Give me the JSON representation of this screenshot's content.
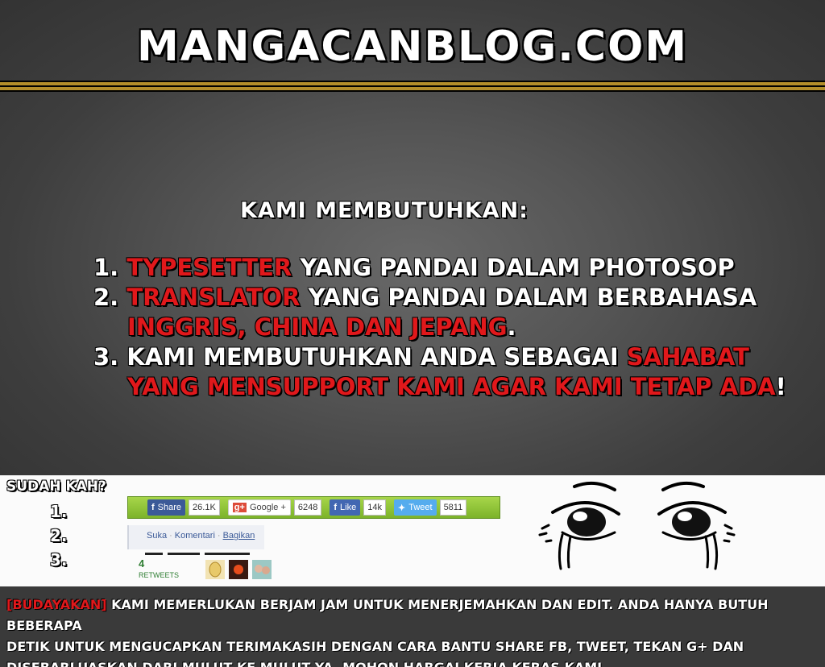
{
  "header": {
    "site_title": "MANGACANBLOG.COM"
  },
  "main": {
    "headline": "KAMI MEMBUTUHKAN:",
    "items": [
      {
        "num": "1.",
        "highlight": "TYPESETTER",
        "text": " YANG PANDAI DALAM PHOTOSOP"
      },
      {
        "num": "2.",
        "highlight": "TRANSLATOR",
        "text": " YANG PANDAI DALAM BERBAHASA",
        "line2_highlight": "INGGRIS, CHINA DAN JEPANG",
        "line2_end": "."
      },
      {
        "num": "3.",
        "text": " KAMI MEMBUTUHKAN ANDA SEBAGAI ",
        "highlight": "SAHABAT",
        "line2_highlight": "YANG MENSUPPORT KAMI AGAR KAMI TETAP ADA",
        "line2_end": "!"
      }
    ]
  },
  "sidebar": {
    "question": "SUDAH KAH?",
    "numbers": [
      "1.",
      "2.",
      "3."
    ]
  },
  "share_bar": {
    "fb_share_label": "Share",
    "fb_share_count": "26.1K",
    "gplus_label": "Google +",
    "gplus_count": "6248",
    "like_label": "Like",
    "like_count": "14k",
    "tweet_label": "Tweet",
    "tweet_count": "5811",
    "colors": {
      "bar": "#8cc43a",
      "facebook": "#3b5a98",
      "twitter": "#55acee",
      "google": "#dd4b39"
    }
  },
  "fb_links": {
    "suka": "Suka",
    "sep": "·",
    "komentari": "Komentari",
    "bagikan": "Bagikan"
  },
  "retweets": {
    "count": "4",
    "label": "RETWEETS"
  },
  "footer": {
    "tag": "[BUDAYAKAN]",
    "line1": " KAMI MEMERLUKAN BERJAM JAM UNTUK MENERJEMAHKAN DAN EDIT. ANDA HANYA BUTUH BEBERAPA",
    "line2": "DETIK UNTUK MENGUCAPKAN TERIMAKASIH DENGAN CARA BANTU SHARE FB, TWEET, TEKAN G+ DAN",
    "line3": "DISEBARLUASKAN DARI MULUT KE MULUT YA, MOHON HARGAI KERJA KERAS KAMI."
  },
  "icons": {
    "facebook": "facebook-icon",
    "google_plus": "google-plus-icon",
    "like": "facebook-like-icon",
    "twitter": "twitter-bird-icon",
    "eyes": "crying-eyes-drawing"
  }
}
